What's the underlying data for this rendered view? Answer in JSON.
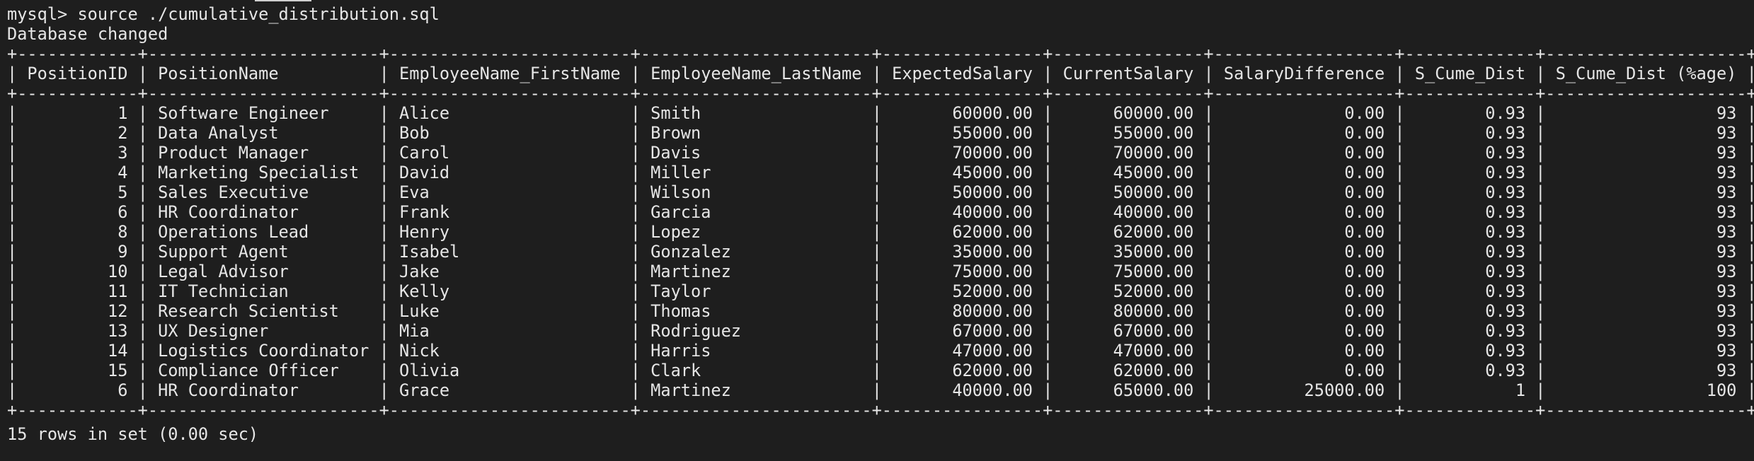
{
  "terminal": {
    "prompt": "mysql> ",
    "command": "source ./cumulative_distribution.sql",
    "db_changed": "Database changed",
    "footer": "15 rows in set (0.00 sec)"
  },
  "table": {
    "headers": [
      "PositionID",
      "PositionName",
      "EmployeeName_FirstName",
      "EmployeeName_LastName",
      "ExpectedSalary",
      "CurrentSalary",
      "SalaryDifference",
      "S_Cume_Dist",
      "S_Cume_Dist (%age)"
    ],
    "rows": [
      [
        "1",
        "Software Engineer",
        "Alice",
        "Smith",
        "60000.00",
        "60000.00",
        "0.00",
        "0.93",
        "93"
      ],
      [
        "2",
        "Data Analyst",
        "Bob",
        "Brown",
        "55000.00",
        "55000.00",
        "0.00",
        "0.93",
        "93"
      ],
      [
        "3",
        "Product Manager",
        "Carol",
        "Davis",
        "70000.00",
        "70000.00",
        "0.00",
        "0.93",
        "93"
      ],
      [
        "4",
        "Marketing Specialist",
        "David",
        "Miller",
        "45000.00",
        "45000.00",
        "0.00",
        "0.93",
        "93"
      ],
      [
        "5",
        "Sales Executive",
        "Eva",
        "Wilson",
        "50000.00",
        "50000.00",
        "0.00",
        "0.93",
        "93"
      ],
      [
        "6",
        "HR Coordinator",
        "Frank",
        "Garcia",
        "40000.00",
        "40000.00",
        "0.00",
        "0.93",
        "93"
      ],
      [
        "8",
        "Operations Lead",
        "Henry",
        "Lopez",
        "62000.00",
        "62000.00",
        "0.00",
        "0.93",
        "93"
      ],
      [
        "9",
        "Support Agent",
        "Isabel",
        "Gonzalez",
        "35000.00",
        "35000.00",
        "0.00",
        "0.93",
        "93"
      ],
      [
        "10",
        "Legal Advisor",
        "Jake",
        "Martinez",
        "75000.00",
        "75000.00",
        "0.00",
        "0.93",
        "93"
      ],
      [
        "11",
        "IT Technician",
        "Kelly",
        "Taylor",
        "52000.00",
        "52000.00",
        "0.00",
        "0.93",
        "93"
      ],
      [
        "12",
        "Research Scientist",
        "Luke",
        "Thomas",
        "80000.00",
        "80000.00",
        "0.00",
        "0.93",
        "93"
      ],
      [
        "13",
        "UX Designer",
        "Mia",
        "Rodriguez",
        "67000.00",
        "67000.00",
        "0.00",
        "0.93",
        "93"
      ],
      [
        "14",
        "Logistics Coordinator",
        "Nick",
        "Harris",
        "47000.00",
        "47000.00",
        "0.00",
        "0.93",
        "93"
      ],
      [
        "15",
        "Compliance Officer",
        "Olivia",
        "Clark",
        "62000.00",
        "62000.00",
        "0.00",
        "0.93",
        "93"
      ],
      [
        "6",
        "HR Coordinator",
        "Grace",
        "Martinez",
        "40000.00",
        "65000.00",
        "25000.00",
        "1",
        "100"
      ]
    ]
  }
}
